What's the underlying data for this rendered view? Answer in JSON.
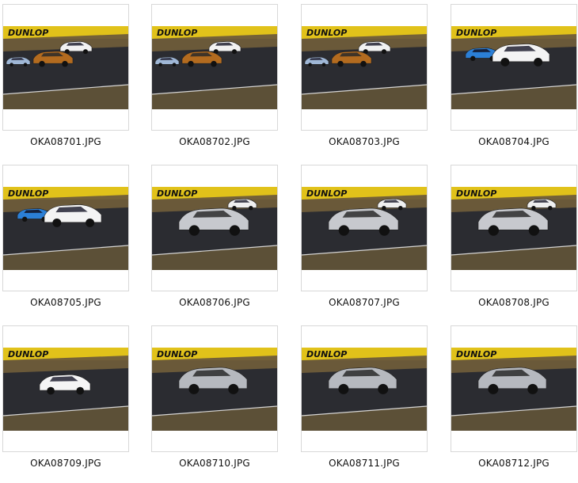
{
  "gallery": {
    "items": [
      {
        "filename": "OKA08701.JPG",
        "icon": "photo-thumbnail",
        "scene": "a",
        "banner_text": "DUNLOP"
      },
      {
        "filename": "OKA08702.JPG",
        "icon": "photo-thumbnail",
        "scene": "a",
        "banner_text": "DUNLOP"
      },
      {
        "filename": "OKA08703.JPG",
        "icon": "photo-thumbnail",
        "scene": "a",
        "banner_text": "DUNLOP"
      },
      {
        "filename": "OKA08704.JPG",
        "icon": "photo-thumbnail",
        "scene": "b",
        "banner_text": "DUNLOP"
      },
      {
        "filename": "OKA08705.JPG",
        "icon": "photo-thumbnail",
        "scene": "b",
        "banner_text": "DUNLOP"
      },
      {
        "filename": "OKA08706.JPG",
        "icon": "photo-thumbnail",
        "scene": "c",
        "banner_text": "DUNLOP"
      },
      {
        "filename": "OKA08707.JPG",
        "icon": "photo-thumbnail",
        "scene": "c",
        "banner_text": "DUNLOP"
      },
      {
        "filename": "OKA08708.JPG",
        "icon": "photo-thumbnail",
        "scene": "c",
        "banner_text": "DUNLOP"
      },
      {
        "filename": "OKA08709.JPG",
        "icon": "photo-thumbnail",
        "scene": "d",
        "banner_text": "DUNLOP"
      },
      {
        "filename": "OKA08710.JPG",
        "icon": "photo-thumbnail",
        "scene": "e",
        "banner_text": "DUNLOP"
      },
      {
        "filename": "OKA08711.JPG",
        "icon": "photo-thumbnail",
        "scene": "e",
        "banner_text": "DUNLOP"
      },
      {
        "filename": "OKA08712.JPG",
        "icon": "photo-thumbnail",
        "scene": "e",
        "banner_text": "DUNLOP"
      }
    ]
  },
  "colors": {
    "banner": "#e1c21a",
    "track": "#2b2c31",
    "grass": "#6e5c3a",
    "border": "#d8d8d8"
  }
}
